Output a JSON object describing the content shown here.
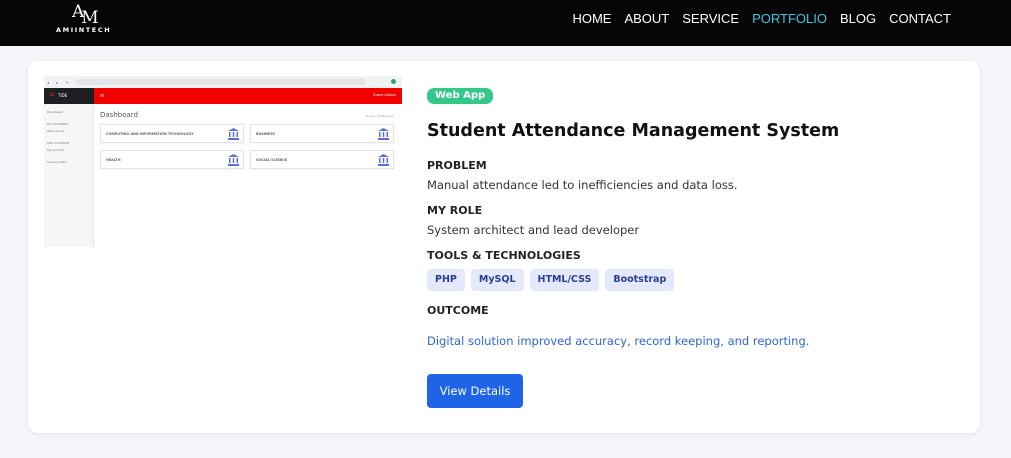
{
  "logo": {
    "mark_a": "A",
    "mark_m": "M",
    "text": "AMIINTECH"
  },
  "nav": {
    "items": [
      {
        "label": "HOME"
      },
      {
        "label": "ABOUT"
      },
      {
        "label": "SERVICE"
      },
      {
        "label": "PORTFOLIO",
        "active": true
      },
      {
        "label": "BLOG"
      },
      {
        "label": "CONTACT"
      }
    ],
    "active_color": "#41c8e6"
  },
  "preview": {
    "brand": "TIDE",
    "sidebar": [
      "Dashboard",
      "MY STUDENTS",
      "Attendance",
      "ADD ACCOUNT",
      "My Account",
      "Classes Data"
    ],
    "user": "Grace Allison",
    "heading": "Dashboard",
    "breadcrumb": "Home / Dashboard",
    "tiles": [
      "COMPUTING AND INFORMATION TECHNOLOGY",
      "BUSINESS",
      "HEALTH",
      "SOCIAL SCIENCE"
    ],
    "icon": "bank-icon"
  },
  "project": {
    "category": "Web App",
    "title": "Student Attendance Management System",
    "problem_heading": "PROBLEM",
    "problem_text": "Manual attendance led to inefficiencies and data loss.",
    "role_heading": "MY ROLE",
    "role_text": "System architect and lead developer",
    "tools_heading": "TOOLS & TECHNOLOGIES",
    "tools": [
      "PHP",
      "MySQL",
      "HTML/CSS",
      "Bootstrap"
    ],
    "outcome_heading": "OUTCOME",
    "outcome_text": "Digital solution improved accuracy, record keeping, and reporting.",
    "cta": "View Details"
  },
  "colors": {
    "badge": "#34c78a",
    "button": "#1f63e6",
    "outcome": "#2f66d1",
    "tag_bg": "#e4e9fd",
    "tag_text": "#2b3e93"
  }
}
